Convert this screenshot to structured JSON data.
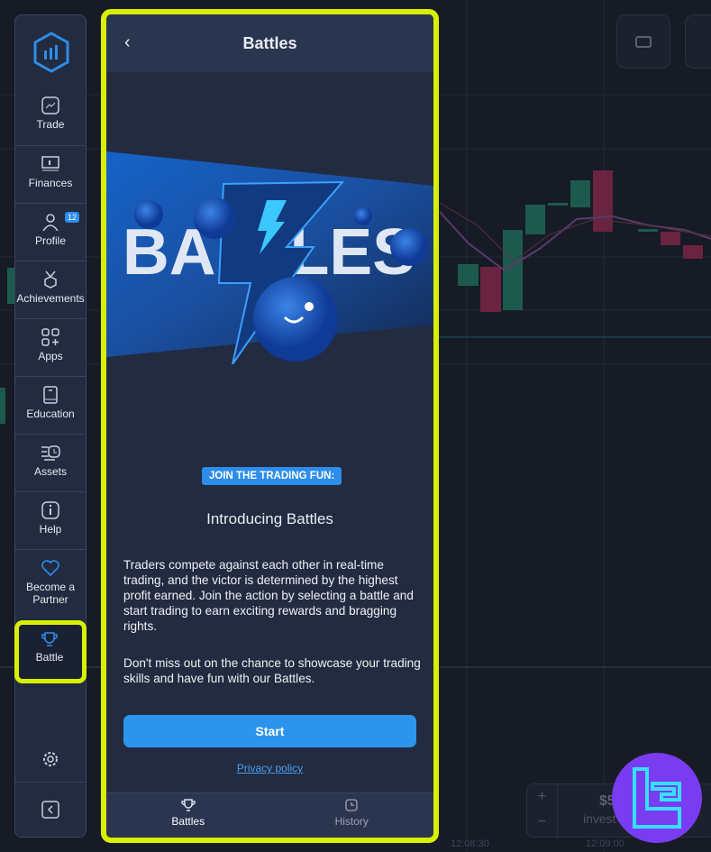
{
  "sidebar": {
    "items": [
      {
        "label": "Trade",
        "icon": "chart-icon"
      },
      {
        "label": "Finances",
        "icon": "wallet-icon"
      },
      {
        "label": "Profile",
        "icon": "user-icon",
        "badge": "12"
      },
      {
        "label": "Achievements",
        "icon": "medal-icon"
      },
      {
        "label": "Apps",
        "icon": "apps-icon"
      },
      {
        "label": "Education",
        "icon": "book-icon"
      },
      {
        "label": "Assets",
        "icon": "assets-clock-icon"
      },
      {
        "label": "Help",
        "icon": "info-icon"
      },
      {
        "label": "Become a Partner",
        "icon": "heart-icon"
      },
      {
        "label": "Battle",
        "icon": "trophy-icon",
        "active": true
      }
    ],
    "settings_icon": "gear-icon",
    "collapse_icon": "chevron-left-icon"
  },
  "panel": {
    "title": "Battles",
    "banner_text": "BATTLES",
    "tag": "JOIN THE TRADING FUN:",
    "heading": "Introducing Battles",
    "paragraph1": "Traders compete against each other in real-time trading, and the victor is determined by the highest profit earned. Join the action by selecting a battle and start trading to earn exciting rewards and bragging rights.",
    "paragraph2": "Don't miss out on the chance to showcase your trading skills and have fun with our Battles.",
    "start_label": "Start",
    "privacy_label": "Privacy policy",
    "tabs": [
      {
        "label": "Battles",
        "icon": "trophy-icon",
        "active": true
      },
      {
        "label": "History",
        "icon": "clock-icon"
      }
    ]
  },
  "background": {
    "invest_amount": "$5",
    "invest_label": "invest",
    "time_labels": [
      "12:08:30",
      "12:09:00"
    ]
  },
  "colors": {
    "accent": "#2d8de9",
    "highlight": "#d8f000",
    "up": "#1d5a4e",
    "down": "#6a2440"
  }
}
